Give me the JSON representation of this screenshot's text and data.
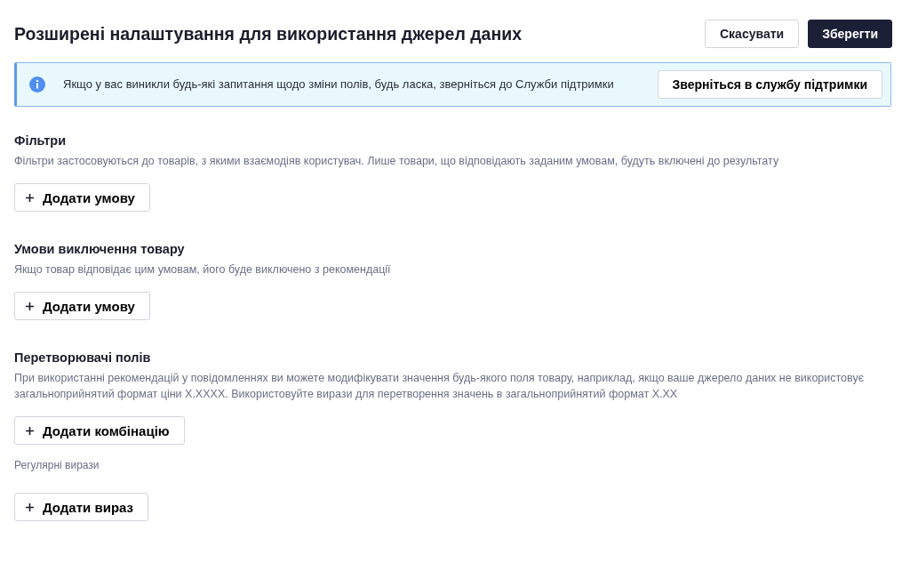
{
  "header": {
    "title": "Розширені налаштування для використання джерел даних",
    "buttons": [
      {
        "label": "Скасувати",
        "kind": "secondary"
      },
      {
        "label": "Зберегти",
        "kind": "primary"
      }
    ]
  },
  "info_banner": {
    "text": "Якщо у вас виникли будь-які запитання щодо зміни полів, будь ласка, зверніться до Служби підтримки",
    "button": "Зверніться в службу підтримки"
  },
  "sections": [
    {
      "blocks": [
        {
          "kind": "title",
          "text": "Фільтри"
        },
        {
          "kind": "description",
          "text": "Фільтри застосовуються до товарів, з якими взаємодіяв користувач. Лише товари, що відповідають заданим умовам, будуть включені до результату"
        },
        {
          "kind": "button",
          "text": "Додати умову"
        }
      ]
    },
    {
      "blocks": [
        {
          "kind": "title",
          "text": "Умови виключення товару"
        },
        {
          "kind": "description",
          "text": "Якщо товар відповідає цим умовам, його буде виключено з рекомендації"
        },
        {
          "kind": "button",
          "text": "Додати умову"
        }
      ]
    },
    {
      "blocks": [
        {
          "kind": "title",
          "text": "Перетворювачі полів"
        },
        {
          "kind": "description",
          "text": "При використанні рекомендацій у повідомленнях ви можете модифікувати значення будь-якого поля товару, наприклад, якщо ваше джерело даних не використовує загальноприйнятий формат ціни X.XXXX. Використовуйте вирази для перетворення значень в загальноприйнятий формат X.XX"
        },
        {
          "kind": "button",
          "text": "Додати комбінацію"
        },
        {
          "kind": "label",
          "text": "Регулярні вирази"
        },
        {
          "kind": "button",
          "text": "Додати вираз"
        }
      ]
    }
  ]
}
